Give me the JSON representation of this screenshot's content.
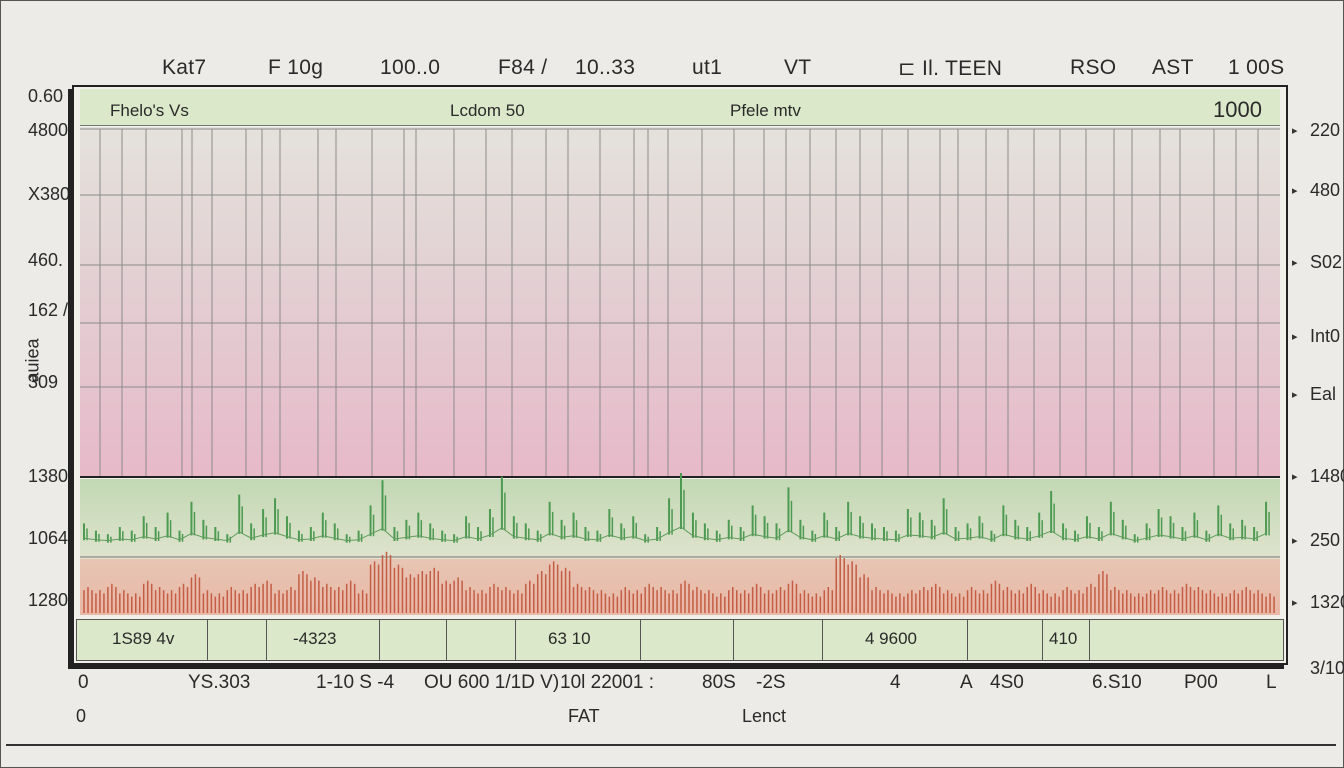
{
  "header_labels": [
    "Kat7",
    "F 10g",
    "100..0",
    "F84 /",
    "10..33",
    "ut1",
    "VT",
    "⊏ Il. TEEN",
    "RSO",
    "AST",
    "1 00S"
  ],
  "left_ticks": [
    "0.60",
    "4800",
    "X380",
    "460.",
    "162 /",
    "309",
    "1380",
    "1064",
    "1280"
  ],
  "right_ticks": [
    "220",
    "480",
    "S02",
    "Int0",
    "Eal",
    "1480",
    "250",
    "1320",
    "3/10"
  ],
  "y_axis_label": "auiea",
  "top_band": {
    "left": "Fhelo's Vs",
    "center": "Lcdom 50",
    "right": "Pfele mtv",
    "value": "1000"
  },
  "bottom_row": [
    "1S89 4v",
    "",
    "-4323",
    "",
    "",
    "63 10",
    "",
    "",
    "4 9600",
    "",
    "410"
  ],
  "x_tick_labels": [
    "0",
    "YS.303",
    "1-10 S -4",
    "OU 600 1/1D V)",
    "10l 22001 :",
    "80S",
    "-2S",
    "4",
    "A",
    "4S0",
    "6.S10",
    "P00",
    "L"
  ],
  "x_names": [
    "0",
    "FAT",
    "Lenct"
  ],
  "chart_data": {
    "type": "bar",
    "title": "",
    "x": [],
    "series": [
      {
        "name": "",
        "color": "#4d9a52",
        "values": [
          6,
          4,
          3,
          5,
          4,
          8,
          5,
          9,
          4,
          12,
          7,
          5,
          3,
          14,
          6,
          10,
          13,
          8,
          4,
          5,
          9,
          6,
          3,
          4,
          11,
          18,
          5,
          7,
          9,
          6,
          4,
          3,
          8,
          5,
          10,
          19,
          8,
          6,
          4,
          12,
          7,
          9,
          5,
          4,
          10,
          6,
          8,
          3,
          5,
          13,
          20,
          9,
          6,
          4,
          7,
          5,
          11,
          8,
          6,
          16,
          7,
          4,
          9,
          5,
          12,
          8,
          6,
          5,
          4,
          10,
          9,
          7,
          13,
          5,
          6,
          8,
          4,
          11,
          7,
          5,
          9,
          15,
          6,
          4,
          8,
          5,
          12,
          7,
          3,
          6,
          10,
          8,
          5,
          9,
          4,
          11,
          6,
          7,
          5,
          12
        ]
      },
      {
        "name": "",
        "color": "#c45d44",
        "values": [
          4,
          3,
          5,
          3,
          2,
          6,
          4,
          3,
          5,
          8,
          3,
          2,
          4,
          3,
          5,
          6,
          3,
          4,
          9,
          7,
          5,
          4,
          6,
          3,
          12,
          15,
          11,
          8,
          9,
          10,
          6,
          7,
          4,
          3,
          5,
          4,
          3,
          6,
          9,
          12,
          10,
          5,
          4,
          3,
          2,
          4,
          3,
          5,
          4,
          3,
          6,
          4,
          3,
          2,
          4,
          3,
          5,
          3,
          4,
          6,
          3,
          2,
          4,
          14,
          12,
          8,
          4,
          3,
          2,
          3,
          4,
          5,
          3,
          2,
          4,
          3,
          6,
          4,
          3,
          5,
          3,
          2,
          4,
          3,
          5,
          9,
          4,
          3,
          2,
          3,
          4,
          3,
          5,
          4,
          3,
          2,
          3,
          4,
          3,
          2
        ]
      }
    ],
    "grid": true
  }
}
